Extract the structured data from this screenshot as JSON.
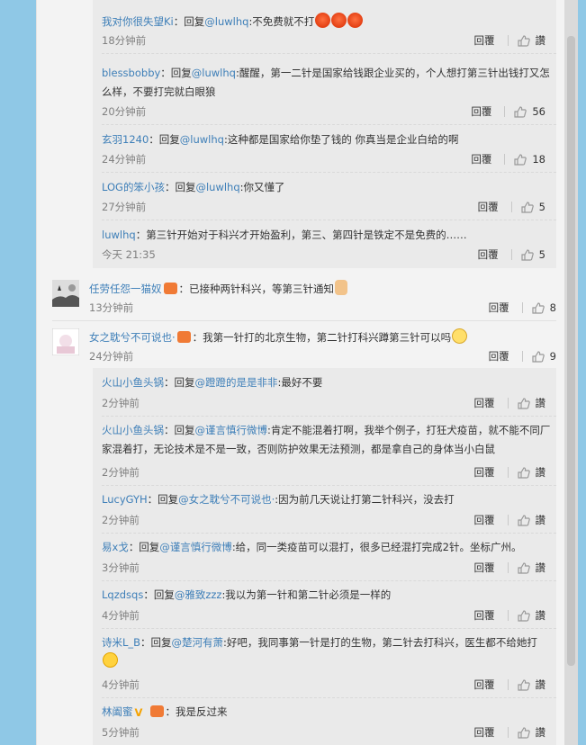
{
  "actions": {
    "reply": "回复",
    "replies": "回覆",
    "like_count_5": "5",
    "like_count_56": "56",
    "like_count_18": "18",
    "like_count_8": "8",
    "like_count_9": "9",
    "like_label": "讚"
  },
  "sub_replies_1": [
    {
      "user": "我对你很失望Ki",
      "reply_label": "：回复",
      "to": "@luwlhq",
      "text": ":不免费就不打",
      "time": "18分钟前",
      "reply": "回覆",
      "like": "讚"
    },
    {
      "user": "blessbobby",
      "reply_label": "：回复",
      "to": "@luwlhq",
      "text": ":醒醒，第一二针是国家给钱跟企业买的，个人想打第三针出钱打又怎么样，不要打完就白眼狼",
      "time": "20分钟前",
      "reply": "回覆",
      "like": "56"
    },
    {
      "user": "玄羽1240",
      "reply_label": "：回复",
      "to": "@luwlhq",
      "text": ":这种都是国家给你垫了钱的 你真当是企业白给的啊",
      "time": "24分钟前",
      "reply": "回覆",
      "like": "18"
    },
    {
      "user": "LOG的笨小孩",
      "reply_label": "：回复",
      "to": "@luwlhq",
      "text": ":你又懂了",
      "time": "27分钟前",
      "reply": "回覆",
      "like": "5"
    },
    {
      "user": "luwlhq",
      "reply_label": "：",
      "to": "",
      "text": "第三针开始对于科兴才开始盈利，第三、第四针是铁定不是免费的……",
      "time": "今天 21:35",
      "reply": "回覆",
      "like": "5"
    }
  ],
  "comment_1": {
    "user": "任劳任怨一猫奴",
    "text": "：已接种两针科兴，等第三针通知",
    "time": "13分钟前",
    "reply": "回覆",
    "like": "8"
  },
  "comment_2": {
    "user": "女之耽兮不可说也·",
    "text": "：我第一针打的北京生物，第二针打科兴蹲第三针可以吗",
    "time": "24分钟前",
    "reply": "回覆",
    "like": "9"
  },
  "sub_replies_2": [
    {
      "user": "火山小鱼头锅",
      "reply_label": "：回复",
      "to": "@蹬蹬的是是非非",
      "text": ":最好不要",
      "time": "2分钟前",
      "reply": "回覆",
      "like": "讚"
    },
    {
      "user": "火山小鱼头锅",
      "reply_label": "：回复",
      "to": "@谨言慎行微博",
      "text": ":肯定不能混着打啊，我举个例子，打狂犬疫苗，就不能不同厂家混着打，无论技术是不是一致，否则防护效果无法预测，都是拿自己的身体当小白鼠",
      "time": "2分钟前",
      "reply": "回覆",
      "like": "讚"
    },
    {
      "user": "LucyGYH",
      "reply_label": "：回复",
      "to": "@女之耽兮不可说也·",
      "text": ":因为前几天说让打第二针科兴，没去打",
      "time": "2分钟前",
      "reply": "回覆",
      "like": "讚"
    },
    {
      "user": "易x戈",
      "reply_label": "：回复",
      "to": "@谨言慎行微博",
      "text": ":给，同一类疫苗可以混打，很多已经混打完成2针。坐标广州。",
      "time": "3分钟前",
      "reply": "回覆",
      "like": "讚"
    },
    {
      "user": "Lqzdsqs",
      "reply_label": "：回复",
      "to": "@雅致zzz",
      "text": ":我以为第一针和第二针必须是一样的",
      "time": "4分钟前",
      "reply": "回覆",
      "like": "讚"
    },
    {
      "user": "诗米L_B",
      "reply_label": "：回复",
      "to": "@楚河有萧",
      "text": ":好吧，我同事第一针是打的生物，第二针去打科兴，医生都不给她打",
      "time": "4分钟前",
      "reply": "回覆",
      "like": "讚"
    },
    {
      "user": "林阖蜜",
      "reply_label": "：",
      "to": "",
      "text": "我是反过来",
      "time": "5分钟前",
      "reply": "回覆",
      "like": "讚"
    }
  ]
}
